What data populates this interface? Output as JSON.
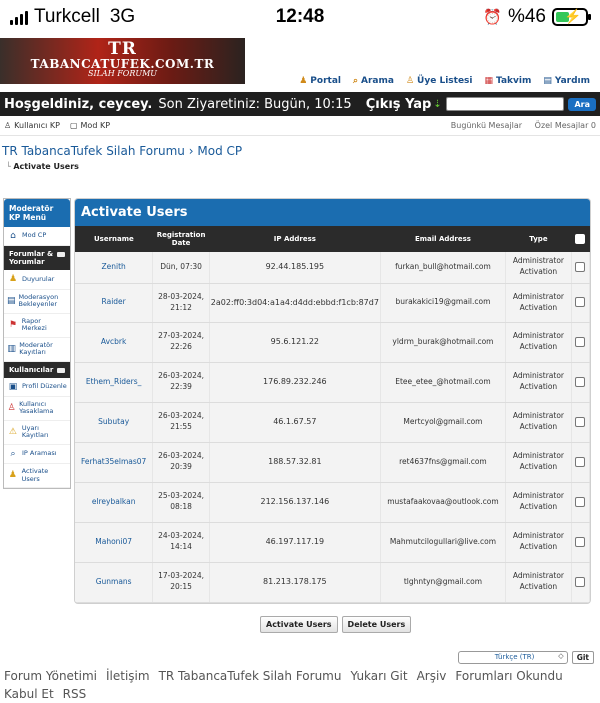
{
  "status": {
    "carrier": "Turkcell",
    "network": "3G",
    "time": "12:48",
    "battery": "%46"
  },
  "logo": {
    "line1": "TR",
    "line2": "TABANCATUFEK.COM.TR",
    "line3": "SILAH FORUMU"
  },
  "topnav": [
    {
      "icon": "portal-icon",
      "label": "Portal"
    },
    {
      "icon": "search-icon",
      "label": "Arama"
    },
    {
      "icon": "members-icon",
      "label": "Üye Listesi"
    },
    {
      "icon": "calendar-icon",
      "label": "Takvim"
    },
    {
      "icon": "help-icon",
      "label": "Yardım"
    }
  ],
  "welcome": {
    "greeting": "Hoşgeldiniz, ceycey.",
    "last_visit": "Son Ziyaretiniz: Bugün, 10:15",
    "logout": "Çıkış Yap",
    "search_button": "Ara"
  },
  "subbar": {
    "user_cp": "Kullanıcı KP",
    "mod_cp": "Mod KP",
    "today_posts": "Bugünkü Mesajlar",
    "private_messages": "Özel Mesajlar 0"
  },
  "breadcrumb": {
    "root": "TR TabancaTufek Silah Forumu",
    "sep": "›",
    "current": "Mod CP",
    "page": "Activate Users"
  },
  "sidebar": {
    "title": "Moderatör KP Menü",
    "home": "Mod CP",
    "section1": "Forumlar & Yorumlar",
    "items1": [
      {
        "icon": "announce-icon",
        "label": "Duyurular"
      },
      {
        "icon": "queue-icon",
        "label": "Moderasyon Bekleyenler"
      },
      {
        "icon": "report-icon",
        "label": "Rapor Merkezi"
      },
      {
        "icon": "log-icon",
        "label": "Moderatör Kayıtları"
      }
    ],
    "section2": "Kullanıcılar",
    "items2": [
      {
        "icon": "profile-icon",
        "label": "Profil Düzenle"
      },
      {
        "icon": "ban-icon",
        "label": "Kullanıcı Yasaklama"
      },
      {
        "icon": "warning-icon",
        "label": "Uyarı Kayıtları"
      },
      {
        "icon": "ip-icon",
        "label": "IP Araması"
      },
      {
        "icon": "activate-icon",
        "label": "Activate Users"
      }
    ]
  },
  "panel": {
    "title": "Activate Users",
    "headers": [
      "Username",
      "Registration Date",
      "IP Address",
      "Email Address",
      "Type"
    ],
    "rows": [
      {
        "username": "Zenith",
        "date": "Dün, 07:30",
        "ip": "92.44.185.195",
        "email": "furkan_bull@hotmail.com",
        "type": "Administrator Activation"
      },
      {
        "username": "Raider",
        "date": "28-03-2024, 21:12",
        "ip": "2a02:ff0:3d04:a1a4:d4dd:ebbd:f1cb:87d7",
        "email": "burakakici19@gmail.com",
        "type": "Administrator Activation"
      },
      {
        "username": "Avcbrk",
        "date": "27-03-2024, 22:26",
        "ip": "95.6.121.22",
        "email": "yldrm_burak@hotmail.com",
        "type": "Administrator Activation"
      },
      {
        "username": "Ethem_Riders_",
        "date": "26-03-2024, 22:39",
        "ip": "176.89.232.246",
        "email": "Etee_etee_@hotmail.com",
        "type": "Administrator Activation"
      },
      {
        "username": "Subutay",
        "date": "26-03-2024, 21:55",
        "ip": "46.1.67.57",
        "email": "Mertcyol@gmail.com",
        "type": "Administrator Activation"
      },
      {
        "username": "Ferhat35elmas07",
        "date": "26-03-2024, 20:39",
        "ip": "188.57.32.81",
        "email": "ret4637fns@gmail.com",
        "type": "Administrator Activation"
      },
      {
        "username": "elreybalkan",
        "date": "25-03-2024, 08:18",
        "ip": "212.156.137.146",
        "email": "mustafaakovaa@outlook.com",
        "type": "Administrator Activation"
      },
      {
        "username": "Mahoni07",
        "date": "24-03-2024, 14:14",
        "ip": "46.197.117.19",
        "email": "Mahmutcilogullari@live.com",
        "type": "Administrator Activation"
      },
      {
        "username": "Gunmans",
        "date": "17-03-2024, 20:15",
        "ip": "81.213.178.175",
        "email": "tlghntyn@gmail.com",
        "type": "Administrator Activation"
      }
    ]
  },
  "actions": {
    "activate": "Activate Users",
    "delete": "Delete Users"
  },
  "language": {
    "selected": "Türkçe (TR)",
    "go": "Git"
  },
  "footer": [
    "Forum Yönetimi",
    "İletişim",
    "TR TabancaTufek Silah Forumu",
    "Yukarı Git",
    "Arşiv",
    "Forumları Okundu Kabul Et",
    "RSS"
  ]
}
